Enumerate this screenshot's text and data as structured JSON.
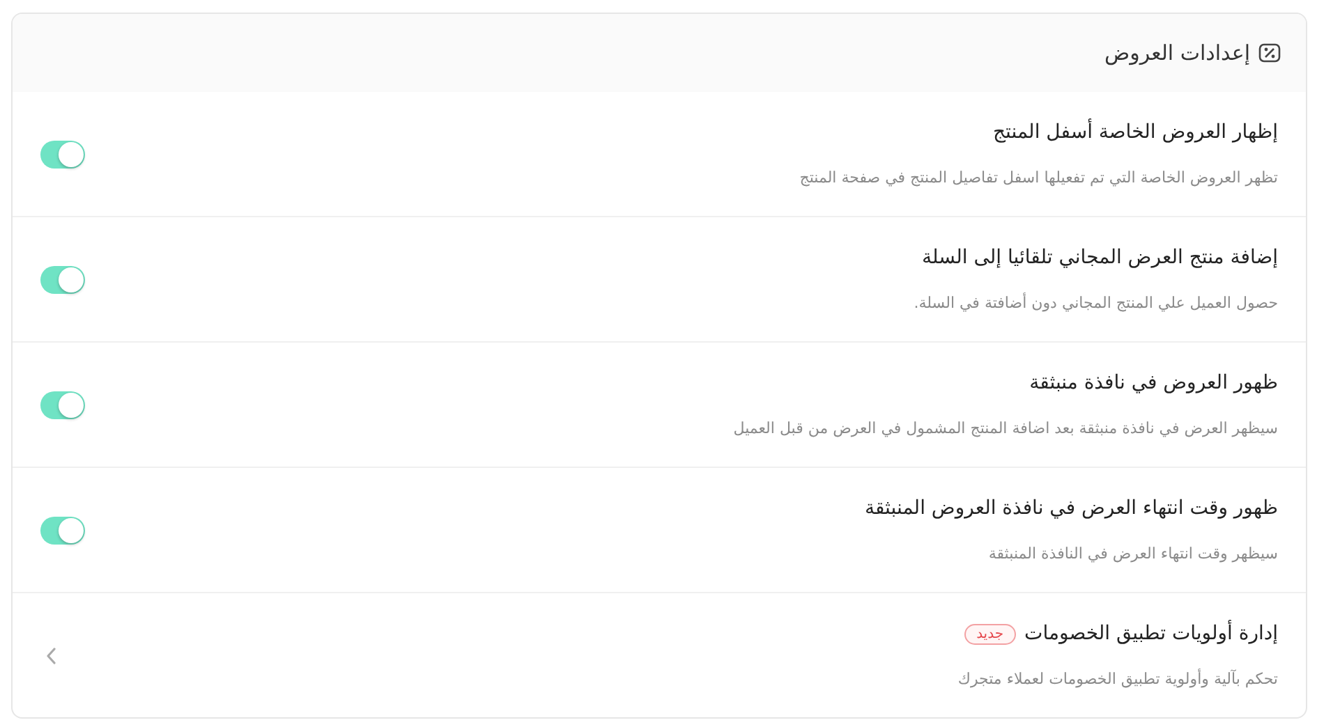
{
  "header": {
    "title": "إعدادات العروض"
  },
  "settings": [
    {
      "kind": "toggle",
      "title": "إظهار العروض الخاصة أسفل المنتج",
      "description": "تظهر العروض الخاصة التي تم تفعيلها اسفل تفاصيل المنتج في صفحة المنتج",
      "on": true
    },
    {
      "kind": "toggle",
      "title": "إضافة منتج العرض المجاني تلقائيا إلى السلة",
      "description": "حصول العميل علي المنتج المجاني دون أضافتة في السلة.",
      "on": true
    },
    {
      "kind": "toggle",
      "title": "ظهور العروض في نافذة منبثقة",
      "description": "سيظهر العرض في نافذة منبثقة بعد اضافة المنتج المشمول في العرض من قبل العميل",
      "on": true
    },
    {
      "kind": "toggle",
      "title": "ظهور وقت انتهاء العرض في نافذة العروض المنبثقة",
      "description": "سيظهر وقت انتهاء العرض في النافذة المنبثقة",
      "on": true
    },
    {
      "kind": "link",
      "title": "إدارة أولويات تطبيق الخصومات",
      "badge": "جديد",
      "description": "تحكم بآلية وأولوية تطبيق الخصومات لعملاء متجرك"
    }
  ]
}
